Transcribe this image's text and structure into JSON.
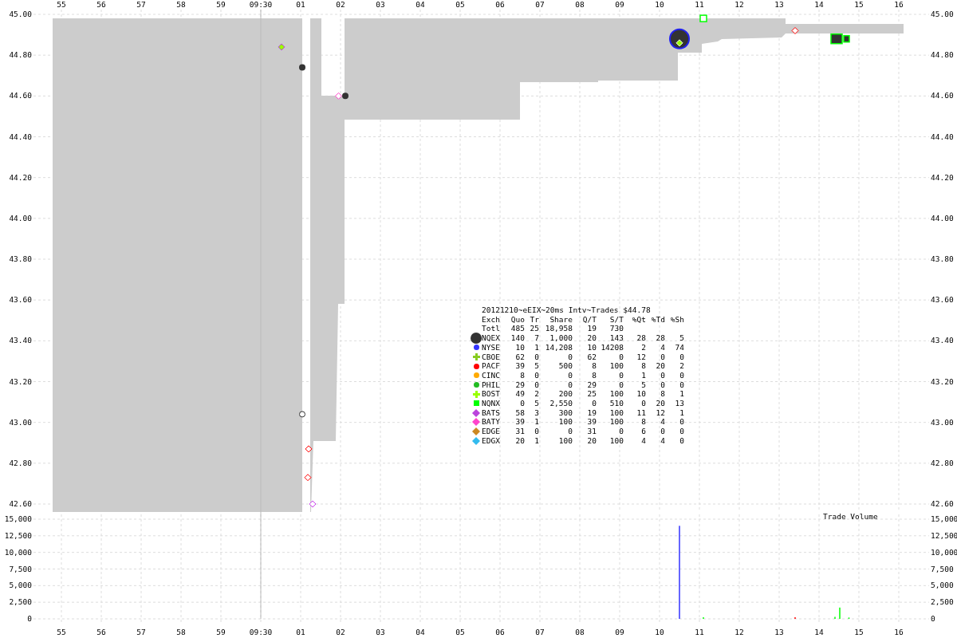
{
  "price_chart": {
    "top_axis_labels": [
      "55",
      "56",
      "57",
      "58",
      "59",
      "09:30",
      "01",
      "02",
      "03",
      "04",
      "05",
      "06",
      "07",
      "08",
      "09",
      "10",
      "11",
      "12",
      "13",
      "14",
      "15",
      "16"
    ],
    "left_labels": [
      "45.00",
      "44.80",
      "44.60",
      "44.40",
      "44.20",
      "44.00",
      "43.80",
      "43.60",
      "43.40",
      "43.20",
      "43.00",
      "42.80",
      "42.60"
    ],
    "right_labels": [
      "45.00",
      "44.80",
      "44.60",
      "44.40",
      "44.20",
      "44.00",
      "43.80",
      "43.60",
      "43.40",
      "43.20",
      "43.00",
      "42.80",
      "42.60"
    ]
  },
  "volume_chart": {
    "title": "Trade Volume",
    "bottom_axis_labels": [
      "55",
      "56",
      "57",
      "58",
      "59",
      "09:30",
      "01",
      "02",
      "03",
      "04",
      "05",
      "06",
      "07",
      "08",
      "09",
      "10",
      "11",
      "12",
      "13",
      "14",
      "15",
      "16"
    ],
    "left_labels": [
      "15,000",
      "12,500",
      "10,000",
      "7,500",
      "5,000",
      "2,500",
      "0"
    ],
    "right_labels": [
      "15,000",
      "12,500",
      "10,000",
      "7,500",
      "5,000",
      "2,500",
      "0"
    ]
  },
  "legend": {
    "title": "20121210~eEIX~20ms Intv~Trades $44.78",
    "columns": [
      "Exch",
      "Quo",
      "Tr",
      "Share",
      "Q/T",
      "S/T",
      "%Qt",
      "%Td",
      "%Sh"
    ],
    "rows": [
      {
        "kind": "none",
        "cells": [
          "Totl",
          "485",
          "25",
          "18,958",
          "19",
          "730"
        ]
      },
      {
        "kind": "large-dot",
        "color": "#333333",
        "cells": [
          "NQEX",
          "140",
          "7",
          "1,000",
          "20",
          "143",
          "28",
          "28",
          "5"
        ]
      },
      {
        "kind": "dot",
        "color": "#3333ff",
        "cells": [
          "NYSE",
          "10",
          "1",
          "14,208",
          "10",
          "14208",
          "2",
          "4",
          "74"
        ]
      },
      {
        "kind": "cross",
        "color": "#88cc22",
        "cells": [
          "CBOE",
          "62",
          "0",
          "0",
          "62",
          "0",
          "12",
          "0",
          "0"
        ]
      },
      {
        "kind": "dot",
        "color": "#ff0000",
        "cells": [
          "PACF",
          "39",
          "5",
          "500",
          "8",
          "100",
          "8",
          "20",
          "2"
        ]
      },
      {
        "kind": "dot",
        "color": "#ffaa00",
        "cells": [
          "CINC",
          "8",
          "0",
          "0",
          "8",
          "0",
          "1",
          "0",
          "0"
        ]
      },
      {
        "kind": "dot",
        "color": "#22bb22",
        "cells": [
          "PHIL",
          "29",
          "0",
          "0",
          "29",
          "0",
          "5",
          "0",
          "0"
        ]
      },
      {
        "kind": "cross",
        "color": "#99ff00",
        "cells": [
          "BOST",
          "49",
          "2",
          "200",
          "25",
          "100",
          "10",
          "8",
          "1"
        ]
      },
      {
        "kind": "square",
        "color": "#00ff00",
        "cells": [
          "NQNX",
          "0",
          "5",
          "2,550",
          "0",
          "510",
          "0",
          "20",
          "13"
        ]
      },
      {
        "kind": "diamond",
        "color": "#bb44dd",
        "cells": [
          "BATS",
          "58",
          "3",
          "300",
          "19",
          "100",
          "11",
          "12",
          "1"
        ]
      },
      {
        "kind": "diamond",
        "color": "#ff44cc",
        "cells": [
          "BATY",
          "39",
          "1",
          "100",
          "39",
          "100",
          "8",
          "4",
          "0"
        ]
      },
      {
        "kind": "diamond",
        "color": "#cc8822",
        "cells": [
          "EDGE",
          "31",
          "0",
          "0",
          "31",
          "0",
          "6",
          "0",
          "0"
        ]
      },
      {
        "kind": "diamond",
        "color": "#33bbee",
        "cells": [
          "EDGX",
          "20",
          "1",
          "100",
          "20",
          "100",
          "4",
          "4",
          "0"
        ]
      }
    ]
  }
}
